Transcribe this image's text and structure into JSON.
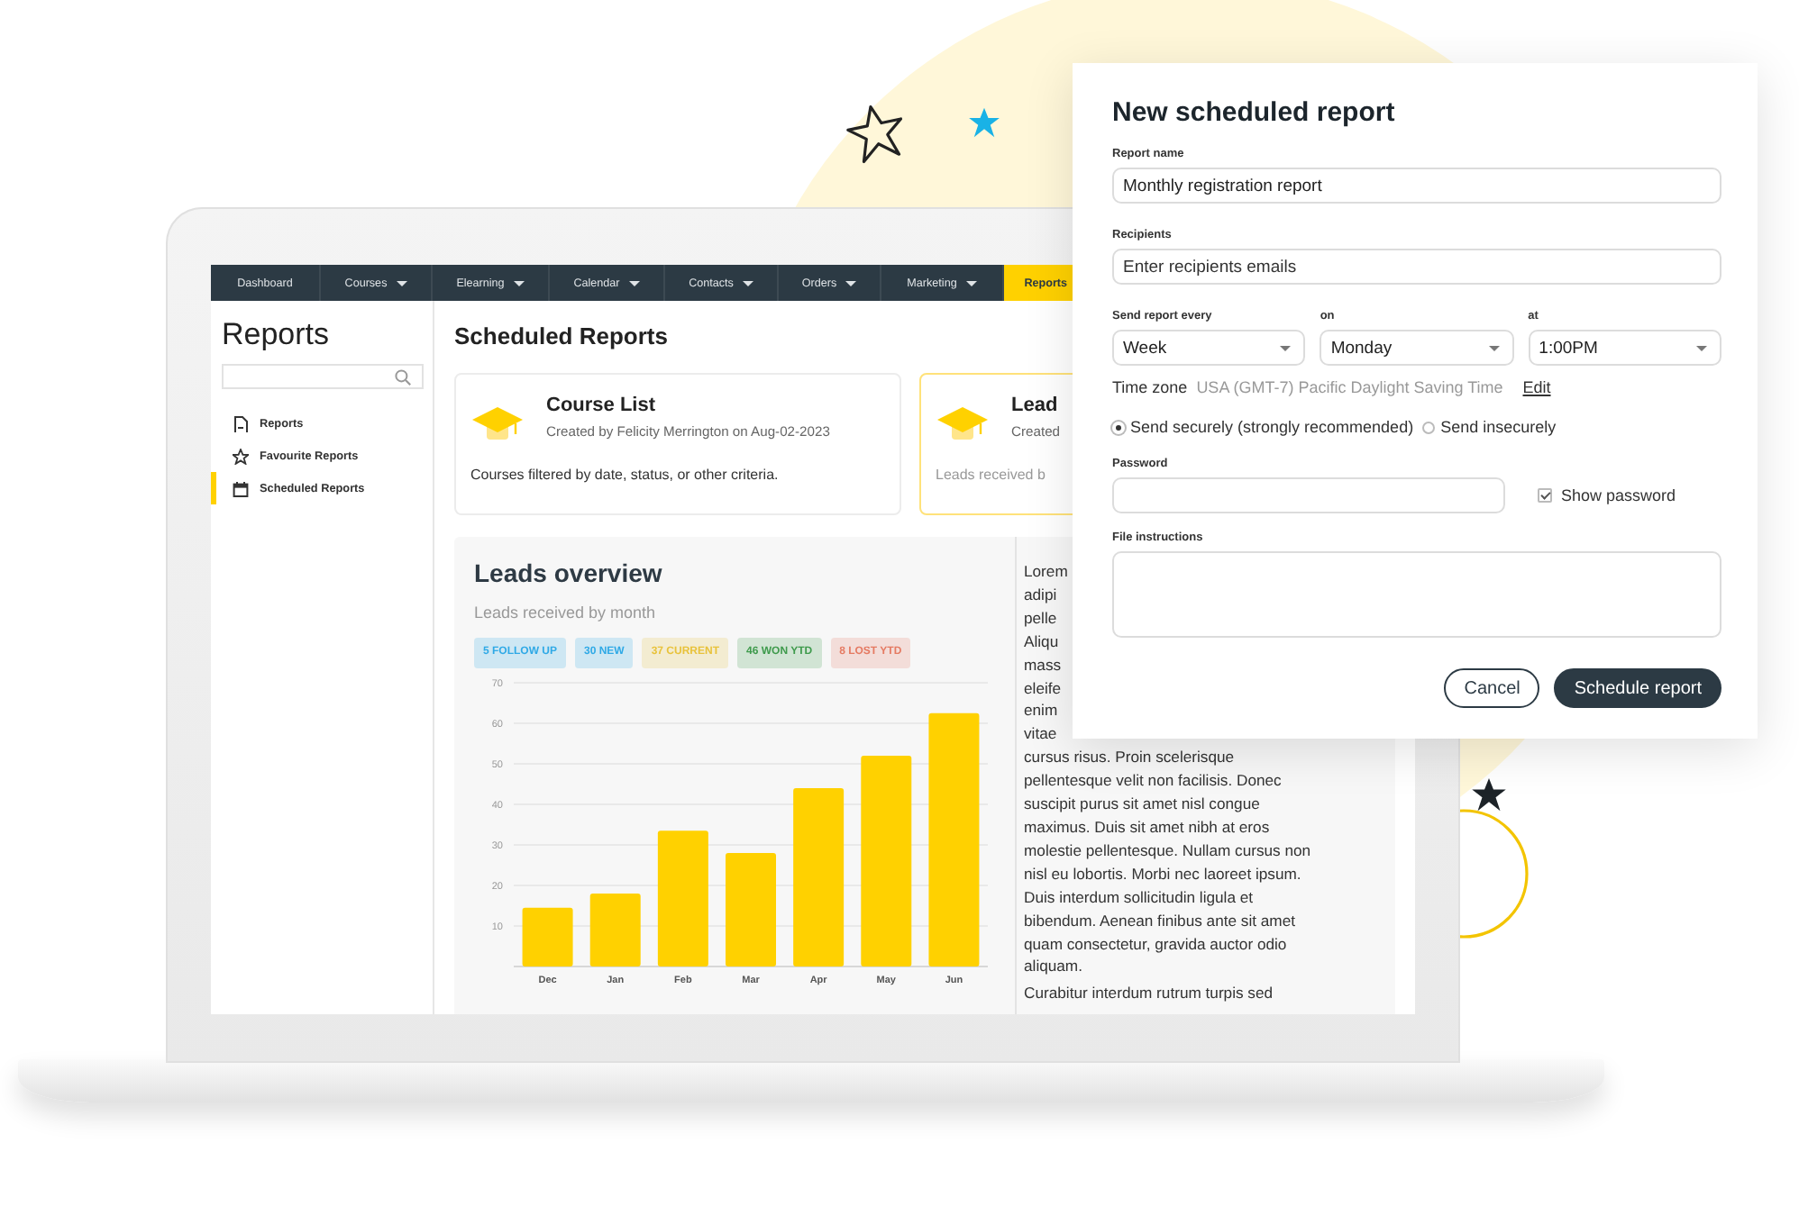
{
  "nav": {
    "items": [
      {
        "label": "Dashboard",
        "dropdown": false,
        "selected": false
      },
      {
        "label": "Courses",
        "dropdown": true,
        "selected": false
      },
      {
        "label": "Elearning",
        "dropdown": true,
        "selected": false
      },
      {
        "label": "Calendar",
        "dropdown": true,
        "selected": false
      },
      {
        "label": "Contacts",
        "dropdown": true,
        "selected": false
      },
      {
        "label": "Orders",
        "dropdown": true,
        "selected": false
      },
      {
        "label": "Marketing",
        "dropdown": true,
        "selected": false
      },
      {
        "label": "Reports",
        "dropdown": false,
        "selected": true
      }
    ]
  },
  "sidebar": {
    "title": "Reports",
    "items": [
      {
        "label": "Reports",
        "kind": "document",
        "selected": false
      },
      {
        "label": "Favourite Reports",
        "kind": "star",
        "selected": false
      },
      {
        "label": "Scheduled Reports",
        "kind": "calendar",
        "selected": true
      }
    ]
  },
  "main": {
    "heading": "Scheduled Reports",
    "cards": [
      {
        "title": "Course List",
        "byline": "Created by Felicity Merrington on Aug-02-2023",
        "description": "Courses filtered by date, status, or other criteria.",
        "selected": false
      },
      {
        "title": "Lead",
        "byline": "Created",
        "description": "Leads received b",
        "selected": true
      }
    ]
  },
  "overview": {
    "title": "Leads overview",
    "subtitle": "Leads received by month",
    "badges": [
      {
        "label": "5 FOLLOW UP",
        "color": "#2fa9e6"
      },
      {
        "label": "30 NEW",
        "color": "#2fa9e6"
      },
      {
        "label": "37 CURRENT",
        "color": "#e8c23a"
      },
      {
        "label": "46 WON YTD",
        "color": "#3e9a4c"
      },
      {
        "label": "8 LOST YTD",
        "color": "#e57a62"
      }
    ],
    "chart_data": {
      "type": "bar",
      "categories": [
        "Dec",
        "Jan",
        "Feb",
        "Mar",
        "Apr",
        "May",
        "Jun"
      ],
      "values": [
        14.5,
        18,
        33.5,
        28,
        44,
        52,
        62.5
      ],
      "ylim": [
        0,
        70
      ],
      "yticks": [
        10,
        20,
        30,
        40,
        50,
        60,
        70
      ],
      "grid": true
    },
    "notes": [
      "Lorem",
      "adipi",
      "pelle",
      "Aliqu",
      "mass",
      "eleife",
      "enim",
      "vitae",
      "cursus risus. Proin scelerisque",
      "pellentesque velit non facilisis. Donec",
      "suscipit purus sit amet nisl congue",
      "maximus. Duis sit amet nibh at eros",
      "molestie pellentesque. Nullam cursus non",
      "nisl eu lobortis. Morbi nec laoreet ipsum.",
      "Duis interdum sollicitudin ligula et",
      "bibendum. Aenean finibus ante sit amet",
      "quam consectetur, gravida auctor odio",
      "aliquam."
    ],
    "notes_2": "Curabitur interdum rutrum turpis sed"
  },
  "dialog": {
    "title": "New scheduled report",
    "fields": [
      {
        "label": "Report name",
        "value": "Monthly registration report"
      },
      {
        "label": "Recipients",
        "placeholder": "Enter recipients emails"
      }
    ],
    "schedule": [
      {
        "label": "Send report every",
        "value": "Week"
      },
      {
        "label": "on",
        "value": "Monday"
      },
      {
        "label": "at",
        "value": "1:00PM"
      }
    ],
    "timezone": {
      "label": "Time zone",
      "value": "USA (GMT-7) Pacific Daylight Saving Time",
      "link": "Edit"
    },
    "delivery": [
      {
        "label": "Send securely (strongly recommended)",
        "selected": true
      },
      {
        "label": "Send insecurely",
        "selected": false
      }
    ],
    "password": {
      "label": "Password"
    },
    "show_password": {
      "label": "Show password",
      "checked": true
    },
    "file_instructions": {
      "label": "File instructions"
    },
    "buttons": [
      {
        "label": "Cancel",
        "kind": "secondary"
      },
      {
        "label": "Schedule report",
        "kind": "primary"
      }
    ]
  }
}
